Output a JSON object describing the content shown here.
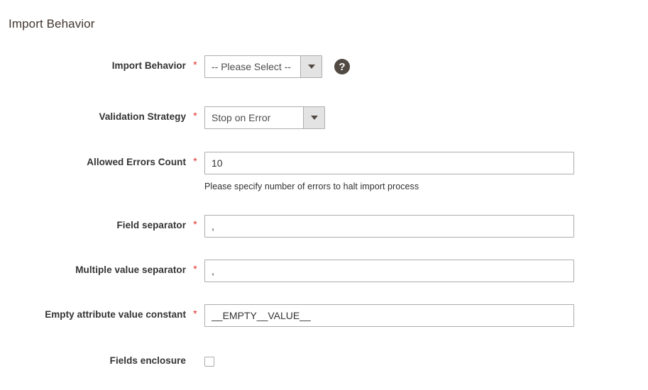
{
  "section": {
    "title": "Import Behavior"
  },
  "fields": [
    {
      "label": "Import Behavior",
      "required_marker": "*",
      "control": "select",
      "value": "-- Please Select --",
      "has_help": true,
      "help_glyph": "?"
    },
    {
      "label": "Validation Strategy",
      "required_marker": "*",
      "control": "select",
      "value": "Stop on Error",
      "has_help": false
    },
    {
      "label": "Allowed Errors Count",
      "required_marker": "*",
      "control": "text",
      "value": "10",
      "note": "Please specify number of errors to halt import process"
    },
    {
      "label": "Field separator",
      "required_marker": "*",
      "control": "text",
      "value": ","
    },
    {
      "label": "Multiple value separator",
      "required_marker": "*",
      "control": "text",
      "value": ","
    },
    {
      "label": "Empty attribute value constant",
      "required_marker": "*",
      "control": "text",
      "value": "__EMPTY__VALUE__"
    },
    {
      "label": "Fields enclosure",
      "required_marker": "",
      "control": "checkbox",
      "checked": false
    }
  ],
  "colors": {
    "required_asterisk": "#e02b27",
    "label_text": "#333333",
    "title_text": "#41362f",
    "input_border": "#adadad",
    "select_button_bg": "#e3e3e3",
    "help_icon_bg": "#514943",
    "page_bg": "#ffffff"
  }
}
